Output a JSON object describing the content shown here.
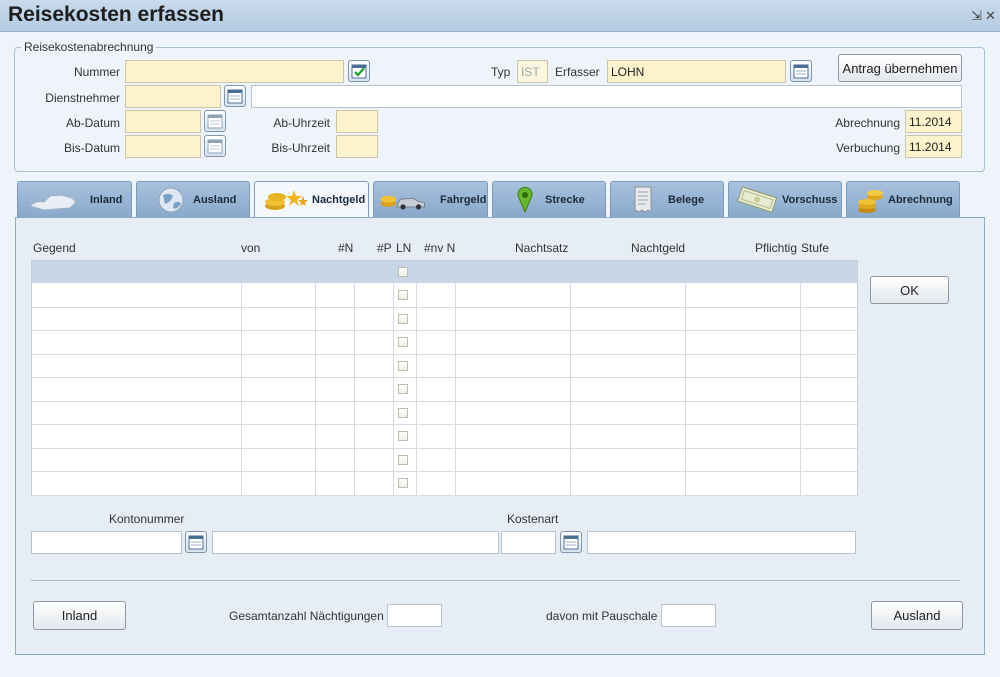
{
  "window": {
    "title": "Reisekosten erfassen",
    "pin_glyph": "⇲",
    "close_glyph": "✕"
  },
  "header": {
    "group_label": "Reisekostenabrechnung",
    "nummer_label": "Nummer",
    "nummer_value": "",
    "typ_label": "Typ",
    "typ_value": "IST",
    "erfasser_label": "Erfasser",
    "erfasser_value": "LOHN",
    "antrag_button": "Antrag übernehmen",
    "dienstnehmer_label": "Dienstnehmer",
    "dienstnehmer_value": "",
    "dienstnehmer_name": "",
    "ab_datum_label": "Ab-Datum",
    "ab_datum_value": "",
    "ab_uhrzeit_label": "Ab-Uhrzeit",
    "ab_uhrzeit_value": "",
    "bis_datum_label": "Bis-Datum",
    "bis_datum_value": "",
    "bis_uhrzeit_label": "Bis-Uhrzeit",
    "bis_uhrzeit_value": "",
    "abrechnung_label": "Abrechnung",
    "abrechnung_value": "11.2014",
    "verbuchung_label": "Verbuchung",
    "verbuchung_value": "11.2014"
  },
  "tabs": [
    {
      "label": "Inland",
      "icon": "austria-map-icon",
      "active": false
    },
    {
      "label": "Ausland",
      "icon": "globe-icon",
      "active": false
    },
    {
      "label": "Nachtgeld",
      "icon": "coins-stars-icon",
      "active": true
    },
    {
      "label": "Fahrgeld",
      "icon": "coins-car-icon",
      "active": false
    },
    {
      "label": "Strecke",
      "icon": "map-pin-icon",
      "active": false
    },
    {
      "label": "Belege",
      "icon": "receipt-icon",
      "active": false
    },
    {
      "label": "Vorschuss",
      "icon": "banknotes-icon",
      "active": false
    },
    {
      "label": "Abrechnung",
      "icon": "coin-stack-icon",
      "active": false
    }
  ],
  "table": {
    "columns": [
      "Gegend",
      "von",
      "#N",
      "#P",
      "LN",
      "#nv N",
      "Nachtsatz",
      "Nachtgeld",
      "Pflichtig",
      "Stufe"
    ],
    "row_count": 10
  },
  "ok_button": "OK",
  "konto": {
    "label": "Kontonummer",
    "value": "",
    "name": ""
  },
  "kostenart": {
    "label": "Kostenart",
    "value": "",
    "name": ""
  },
  "footer": {
    "inland_button": "Inland",
    "gesamt_label": "Gesamtanzahl Nächtigungen",
    "gesamt_value": "",
    "pauschale_label": "davon mit Pauschale",
    "pauschale_value": "",
    "ausland_button": "Ausland"
  },
  "colors": {
    "field_yellow": "#fcf3cd",
    "tab_blue": "#93b2d2",
    "active_tab": "#f4f8fc",
    "title_bar": "#c9dbec"
  }
}
